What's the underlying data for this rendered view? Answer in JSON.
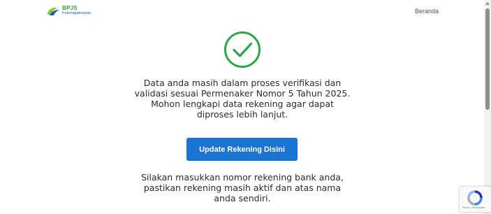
{
  "header": {
    "logo_title": "BPJS",
    "logo_subtitle": "Ketenagakerjaan",
    "nav_link": "Beranda"
  },
  "main": {
    "status_icon": "check-circle-icon",
    "message": "Data anda masih dalam proses verifikasi dan validasi sesuai Permenaker Nomor 5 Tahun 2025. Mohon lengkapi data rekening agar dapat diproses lebih lanjut.",
    "button_label": "Update Rekening Disini",
    "instruction": "Silakan masukkan nomor rekening bank anda, pastikan rekening masih aktif dan atas nama anda sendiri."
  },
  "recaptcha": {
    "icon": "recaptcha-icon",
    "footer_text": "Privasi - Persyaratan"
  },
  "colors": {
    "success_green": "#28a745",
    "button_blue": "#1a75d2",
    "logo_green": "#3a9c3a",
    "logo_blue": "#1d5fa8"
  }
}
